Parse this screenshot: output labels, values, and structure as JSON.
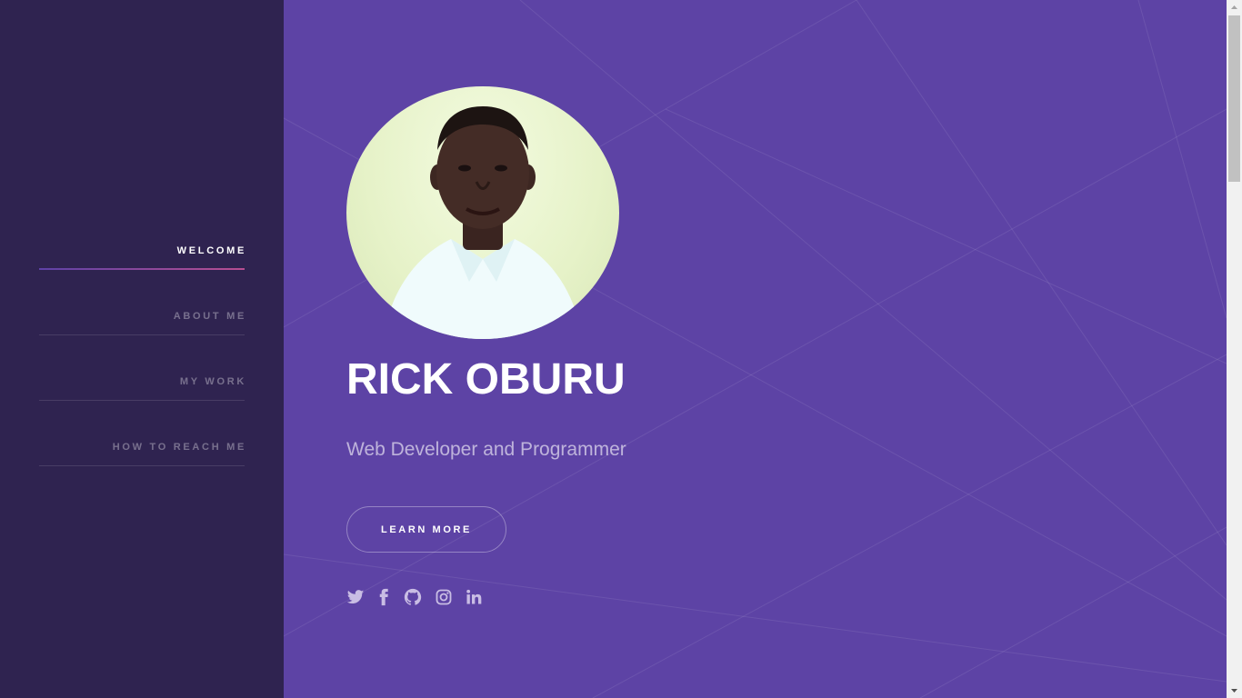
{
  "sidebar": {
    "items": [
      {
        "label": "WELCOME",
        "active": true
      },
      {
        "label": "ABOUT ME",
        "active": false
      },
      {
        "label": "MY WORK",
        "active": false
      },
      {
        "label": "HOW TO REACH ME",
        "active": false
      }
    ]
  },
  "hero": {
    "name": "RICK OBURU",
    "tagline": "Web Developer and Programmer",
    "cta_label": "LEARN MORE",
    "social_icons": [
      "twitter-icon",
      "facebook-icon",
      "github-icon",
      "instagram-icon",
      "linkedin-icon"
    ]
  },
  "colors": {
    "sidebar_bg": "#2f2350",
    "main_bg": "#5d43a5",
    "accent_start": "#5e42a6",
    "accent_end": "#b74e91",
    "icon_color": "#c9bde4"
  }
}
